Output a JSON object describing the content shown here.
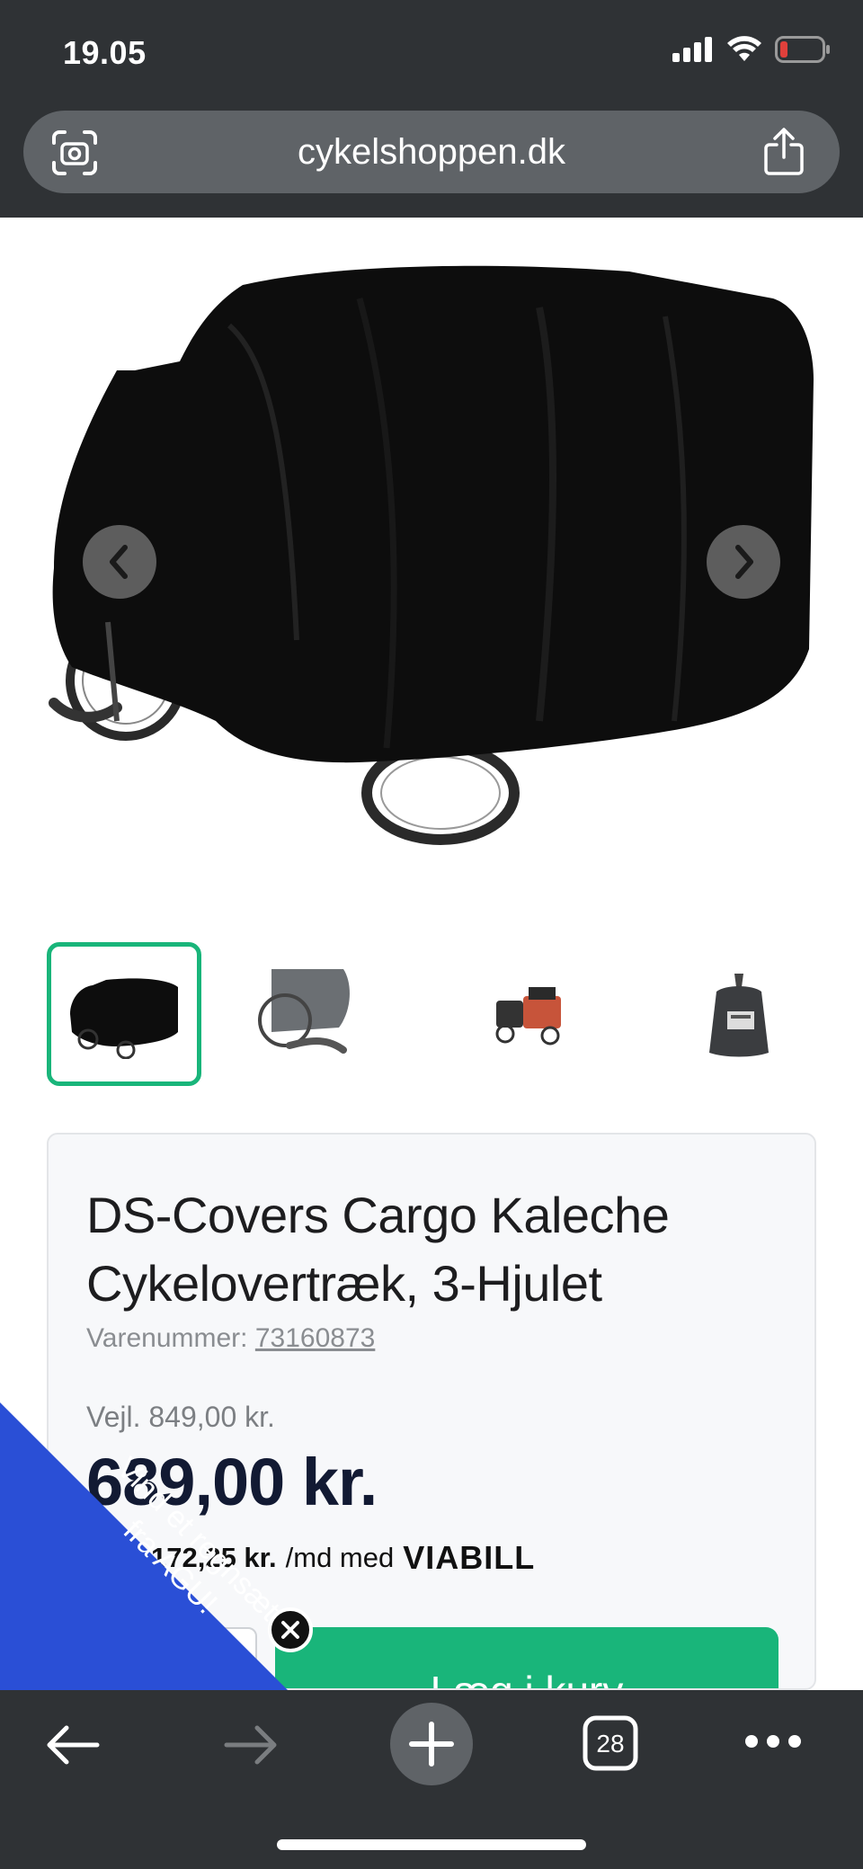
{
  "status_bar": {
    "time": "19.05",
    "icons": [
      "signal-icon",
      "wifi-icon",
      "battery-low-icon"
    ]
  },
  "browser": {
    "url": "cykelshoppen.dk",
    "left_icon": "camera-scan-icon",
    "right_icon": "share-icon"
  },
  "gallery": {
    "prev_icon": "chevron-left-icon",
    "next_icon": "chevron-right-icon",
    "thumbnails": [
      "cover-front",
      "cover-detail",
      "cargo-bike",
      "storage-bag"
    ],
    "active_thumbnail": 0
  },
  "product": {
    "title_line1": "DS-Covers Cargo Kaleche",
    "title_line2": "Cykelovertræk, 3-Hjulet",
    "sku_label": "Varenummer:",
    "sku_value": "73160873",
    "msrp": "Vejl. 849,00 kr.",
    "price": "689,00 kr.",
    "financing_amount": "172,25 kr.",
    "financing_text": "/md med",
    "financing_logo": "VIABILL",
    "add_to_cart_label": "Læg i kurv"
  },
  "promo": {
    "line1": "Vind et regnsæt",
    "line2": "fra AGU!"
  },
  "toolbar": {
    "tabs_count": "28",
    "icons": [
      "back-arrow-icon",
      "forward-arrow-icon",
      "new-tab-icon",
      "tabs-icon",
      "more-icon"
    ]
  },
  "colors": {
    "accent_green": "#19b57a",
    "promo_blue": "#2a4fd6",
    "chrome_dark": "#2f3235"
  }
}
